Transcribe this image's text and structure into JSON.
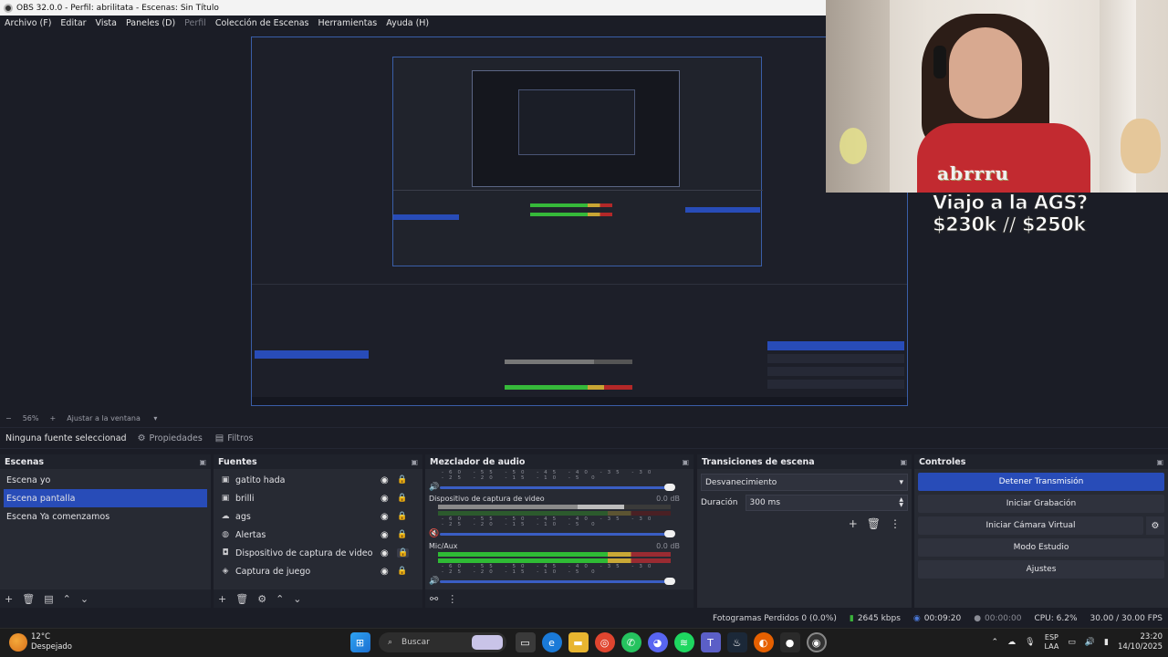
{
  "window": {
    "title": "OBS 32.0.0 - Perfil: abrilitata - Escenas: Sin Título"
  },
  "menu": [
    "Archivo (F)",
    "Editar",
    "Vista",
    "Paneles (D)",
    "Perfil",
    "Colección de Escenas",
    "Herramientas",
    "Ayuda (H)"
  ],
  "overlay": {
    "line1": "Viajo a la AGS?",
    "line2": "$230k // $250k",
    "logo": "abrrru"
  },
  "zoom": {
    "level": "56%",
    "fit": "Ajustar a la ventana"
  },
  "source_toolbar": {
    "no_source": "Ninguna fuente seleccionad",
    "properties": "Propiedades",
    "filters": "Filtros"
  },
  "scenes": {
    "title": "Escenas",
    "items": [
      "Escena yo",
      "Escena pantalla",
      "Escena Ya comenzamos"
    ],
    "selected_index": 1
  },
  "sources": {
    "title": "Fuentes",
    "items": [
      {
        "label": "gatito hada",
        "icon": "image-icon"
      },
      {
        "label": "brilli",
        "icon": "image-icon"
      },
      {
        "label": "ags",
        "icon": "cloud-icon"
      },
      {
        "label": "Alertas",
        "icon": "globe-icon"
      },
      {
        "label": "Dispositivo de captura de video",
        "icon": "camera-icon"
      },
      {
        "label": "Captura de juego",
        "icon": "gamepad-icon"
      }
    ]
  },
  "mixer": {
    "title": "Mezclador de audio",
    "channels": [
      {
        "name": "Dispositivo de captura de video",
        "db": "0.0 dB"
      },
      {
        "name": "Mic/Aux",
        "db": "0.0 dB"
      }
    ],
    "scale": "-60 -55 -50 -45 -40 -35 -30 -25 -20 -15 -10 -5 0"
  },
  "transitions": {
    "title": "Transiciones de escena",
    "selected": "Desvanecimiento",
    "duration_label": "Duración",
    "duration_value": "300 ms"
  },
  "controls": {
    "title": "Controles",
    "stop_stream": "Detener Transmisión",
    "start_record": "Iniciar Grabación",
    "virtual_cam": "Iniciar Cámara Virtual",
    "studio_mode": "Modo Estudio",
    "settings": "Ajustes"
  },
  "status": {
    "dropped": "Fotogramas Perdidos 0 (0.0%)",
    "bitrate": "2645 kbps",
    "stream_time": "00:09:20",
    "rec_time": "00:00:00",
    "cpu": "CPU: 6.2%",
    "fps": "30.00 / 30.00 FPS"
  },
  "taskbar": {
    "temp": "12°C",
    "weather": "Despejado",
    "search": "Buscar",
    "lang_top": "ESP",
    "lang_bottom": "LAA",
    "time": "23:20",
    "date": "14/10/2025"
  },
  "colors": {
    "accent": "#284cb8",
    "panel": "#272a33",
    "bg": "#1b1d26"
  }
}
